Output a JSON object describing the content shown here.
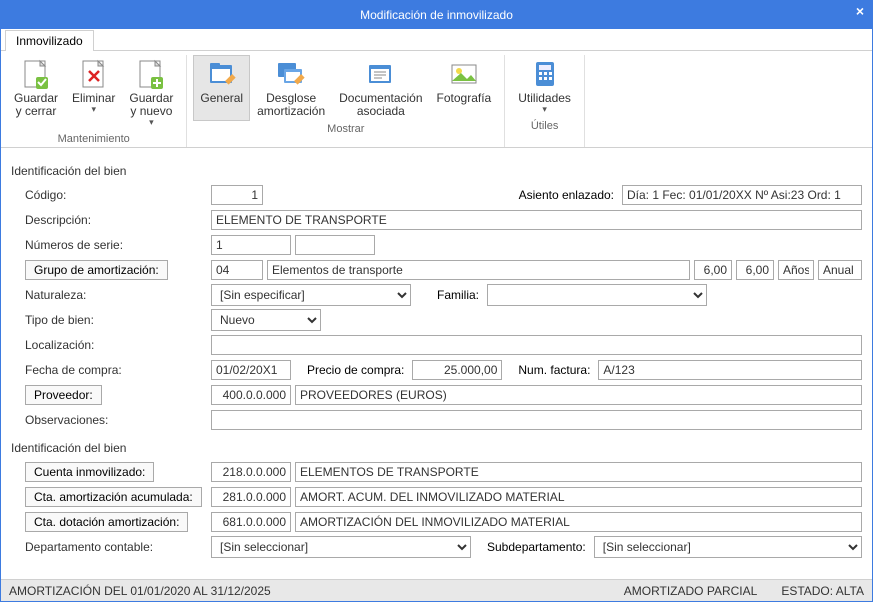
{
  "window": {
    "title": "Modificación de inmovilizado"
  },
  "tab": {
    "label": "Inmovilizado"
  },
  "ribbon": {
    "maintenance": {
      "save_close": "Guardar y cerrar",
      "delete": "Eliminar",
      "save_new": "Guardar y nuevo",
      "caption": "Mantenimiento"
    },
    "show": {
      "general": "General",
      "breakdown": "Desglose amortización",
      "docs": "Documentación asociada",
      "photo": "Fotografía",
      "caption": "Mostrar"
    },
    "utils": {
      "utilities": "Utilidades",
      "caption": "Útiles"
    }
  },
  "section1": {
    "title": "Identificación del bien"
  },
  "fields1": {
    "codigo_label": "Código:",
    "codigo_value": "1",
    "asiento_label": "Asiento enlazado:",
    "asiento_value": "Día: 1 Fec: 01/01/20XX Nº Asi:23 Ord: 1",
    "descripcion_label": "Descripción:",
    "descripcion_value": "ELEMENTO DE TRANSPORTE",
    "nserie_label": "Números de serie:",
    "nserie_value": "1",
    "grupo_button": "Grupo de amortización:",
    "grupo_code": "04",
    "grupo_name": "Elementos de transporte",
    "grupo_v1": "6,00",
    "grupo_v2": "6,00",
    "grupo_unit": "Años",
    "grupo_period": "Anual",
    "naturaleza_label": "Naturaleza:",
    "naturaleza_value": "[Sin especificar]",
    "familia_label": "Familia:",
    "tipo_label": "Tipo de bien:",
    "tipo_value": "Nuevo",
    "localizacion_label": "Localización:",
    "fecha_label": "Fecha de compra:",
    "fecha_value": "01/02/20X1",
    "precio_label": "Precio de compra:",
    "precio_value": "25.000,00",
    "numfac_label": "Num. factura:",
    "numfac_value": "A/123",
    "proveedor_button": "Proveedor:",
    "proveedor_code": "400.0.0.000",
    "proveedor_name": "PROVEEDORES (EUROS)",
    "observaciones_label": "Observaciones:"
  },
  "section2": {
    "title": "Identificación del bien"
  },
  "fields2": {
    "cuenta_inm_button": "Cuenta inmovilizado:",
    "cuenta_inm_code": "218.0.0.000",
    "cuenta_inm_name": "ELEMENTOS DE TRANSPORTE",
    "cta_amort_button": "Cta. amortización acumulada:",
    "cta_amort_code": "281.0.0.000",
    "cta_amort_name": "AMORT. ACUM. DEL INMOVILIZADO MATERIAL",
    "cta_dot_button": "Cta. dotación amortización:",
    "cta_dot_code": "681.0.0.000",
    "cta_dot_name": "AMORTIZACIÓN DEL INMOVILIZADO MATERIAL",
    "depto_label": "Departamento contable:",
    "depto_value": "[Sin seleccionar]",
    "subdepto_label": "Subdepartamento:",
    "subdepto_value": "[Sin seleccionar]"
  },
  "status": {
    "left": "AMORTIZACIÓN DEL 01/01/2020 AL 31/12/2025",
    "mid": "AMORTIZADO PARCIAL",
    "right": "ESTADO: ALTA"
  }
}
